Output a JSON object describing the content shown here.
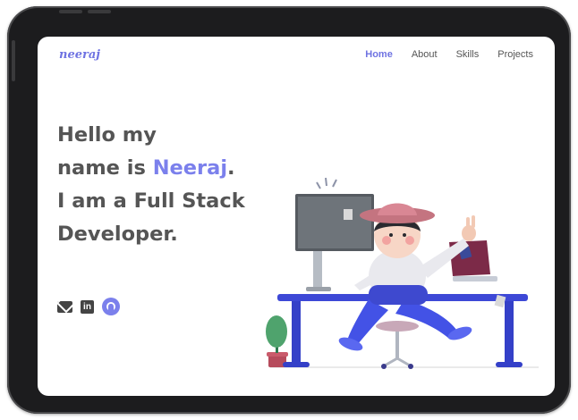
{
  "logo": "neeraj",
  "nav": {
    "items": [
      "Home",
      "About",
      "Skills",
      "Projects"
    ],
    "active": "Home"
  },
  "hero": {
    "line1": "Hello my",
    "line2_prefix": "name is ",
    "line2_name": "Neeraj",
    "line2_suffix": ".",
    "line3": "I am a Full Stack",
    "line4": "Developer."
  },
  "socials": [
    "email-icon",
    "linkedin-icon",
    "github-icon"
  ],
  "linkedin_glyph": "in",
  "colors": {
    "accent": "#7b80ec",
    "text": "#555555",
    "device_frame": "#1c1c1e"
  }
}
